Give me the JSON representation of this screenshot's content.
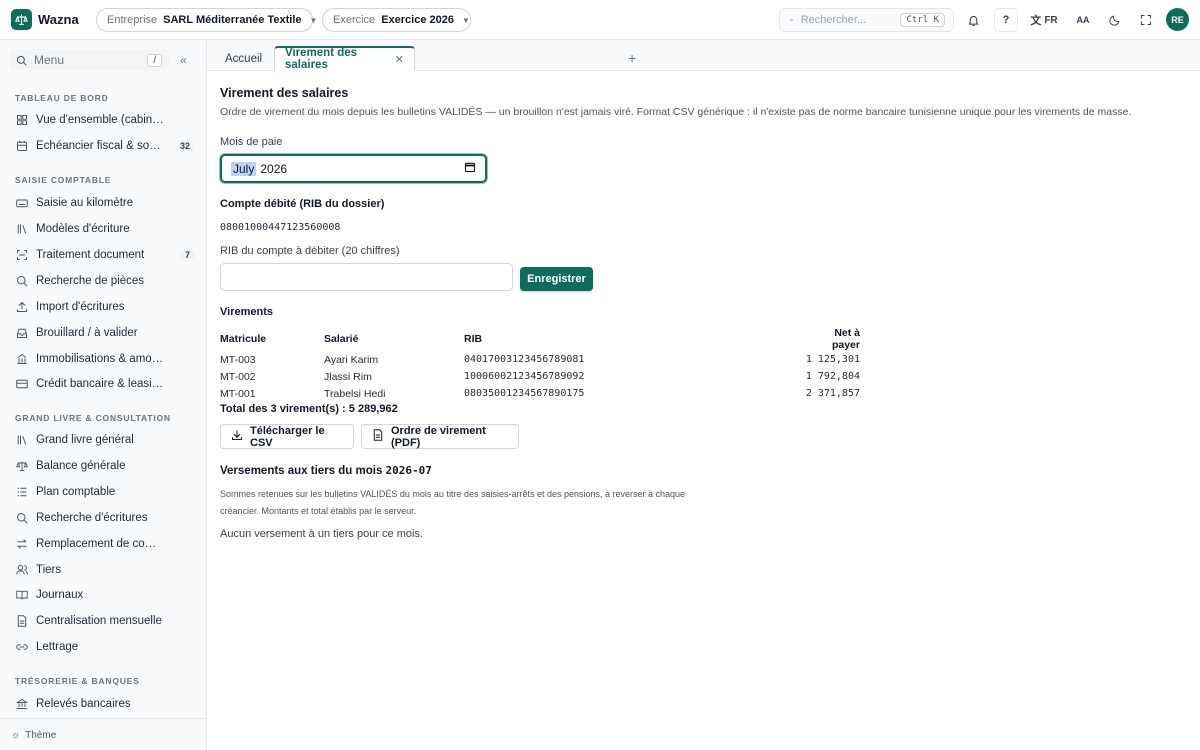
{
  "app": {
    "name": "Wazna"
  },
  "topbar": {
    "entreprise_label": "Entreprise",
    "entreprise_value": "SARL Méditerranée Textile",
    "exercice_label": "Exercice",
    "exercice_value": "Exercice 2026",
    "search_placeholder": "Rechercher...",
    "search_shortcut": "Ctrl K",
    "help_label": "?",
    "lang": "FR",
    "font_size_label": "AA",
    "avatar": "RE"
  },
  "sidebar": {
    "menu_placeholder": "Menu",
    "menu_shortcut": "/",
    "sections": [
      {
        "title": "TABLEAU DE BORD",
        "items": [
          {
            "label": "Vue d'ensemble (cabinet)",
            "icon": "grid-icon"
          },
          {
            "label": "Échéancier fiscal & social",
            "icon": "calendar-icon",
            "badge": "32"
          }
        ]
      },
      {
        "title": "SAISIE COMPTABLE",
        "items": [
          {
            "label": "Saisie au kilomètre",
            "icon": "keyboard-icon"
          },
          {
            "label": "Modèles d'écriture",
            "icon": "library-icon"
          },
          {
            "label": "Traitement document",
            "icon": "scan-icon",
            "badge": "7"
          },
          {
            "label": "Recherche de pièces",
            "icon": "search-icon"
          },
          {
            "label": "Import d'écritures",
            "icon": "upload-icon"
          },
          {
            "label": "Brouillard / à valider",
            "icon": "inbox-icon"
          },
          {
            "label": "Immobilisations & amortissements",
            "icon": "building-icon"
          },
          {
            "label": "Crédit bancaire & leasing",
            "icon": "card-icon"
          }
        ]
      },
      {
        "title": "GRAND LIVRE & CONSULTATION",
        "items": [
          {
            "label": "Grand livre général",
            "icon": "library-icon"
          },
          {
            "label": "Balance générale",
            "icon": "scale-icon"
          },
          {
            "label": "Plan comptable",
            "icon": "list-icon"
          },
          {
            "label": "Recherche d'écritures",
            "icon": "search-icon"
          },
          {
            "label": "Remplacement de compte",
            "icon": "swap-icon"
          },
          {
            "label": "Tiers",
            "icon": "users-icon"
          },
          {
            "label": "Journaux",
            "icon": "book-icon"
          },
          {
            "label": "Centralisation mensuelle",
            "icon": "file-icon"
          },
          {
            "label": "Lettrage",
            "icon": "link-icon"
          }
        ]
      },
      {
        "title": "TRÉSORERIE & BANQUES",
        "items": [
          {
            "label": "Relevés bancaires",
            "icon": "bank-icon"
          }
        ]
      }
    ],
    "theme_label": "Thème"
  },
  "tabs": [
    {
      "label": "Accueil",
      "active": false
    },
    {
      "label": "Virement des salaires",
      "active": true
    }
  ],
  "main": {
    "title": "Virement des salaires",
    "subtitle": "Ordre de virement du mois depuis les bulletins VALIDÉS — un brouillon n'est jamais viré. Format CSV générique : il n'existe pas de norme bancaire tunisienne unique pour les virements de masse.",
    "month_label": "Mois de paie",
    "month_value_month": "July",
    "month_value_year": "2026",
    "debit_account_title": "Compte débité (RIB du dossier)",
    "debit_account_rib": "08001000447123560008",
    "rib_input_label": "RIB du compte à débiter (20 chiffres)",
    "rib_input_value": "",
    "save_button": "Enregistrer",
    "transfers_title": "Virements",
    "table": {
      "headers": [
        "Matricule",
        "Salarié",
        "RIB",
        "Net à payer"
      ],
      "rows": [
        {
          "matricule": "MT-003",
          "salarie": "Ayari Karim",
          "rib": "04017003123456789081",
          "net": "1 125,301"
        },
        {
          "matricule": "MT-002",
          "salarie": "Jlassi Rim",
          "rib": "10006002123456789092",
          "net": "1 792,804"
        },
        {
          "matricule": "MT-001",
          "salarie": "Trabelsi Hedi",
          "rib": "08035001234567890175",
          "net": "2 371,857"
        }
      ]
    },
    "total_prefix": "Total des 3 virement(s) : ",
    "total_value": "5 289,962",
    "csv_button": "Télécharger le CSV",
    "pdf_button": "Ordre de virement (PDF)",
    "third_party_title": "Versements aux tiers du mois ",
    "third_party_month": "2026-07",
    "third_party_note": "Sommes retenues sur les bulletins VALIDÉS du mois au titre des saisies-arrêts et des pensions, à reverser à chaque créancier. Montants et total établis par le serveur.",
    "third_party_empty": "Aucun versement à un tiers pour ce mois."
  },
  "colors": {
    "accent": "#0f6b5b"
  }
}
